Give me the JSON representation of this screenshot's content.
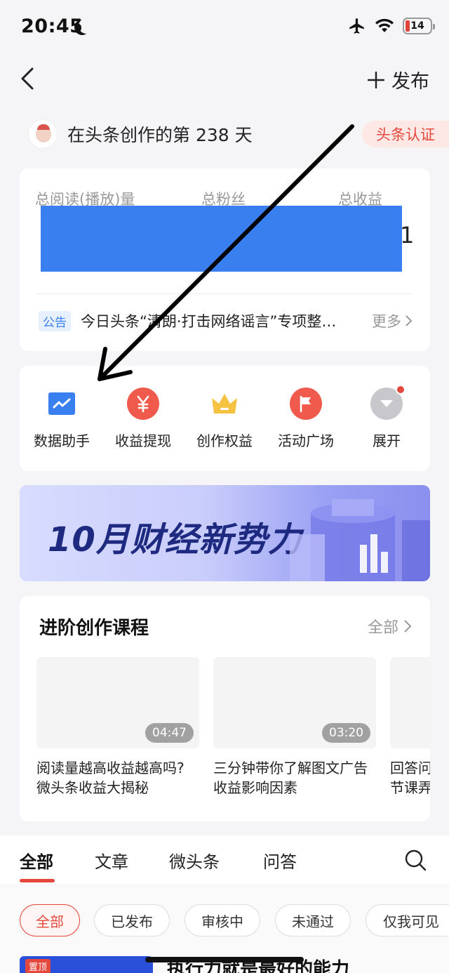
{
  "status_bar": {
    "time": "20:45",
    "battery": "14"
  },
  "nav": {
    "publish_label": "发布"
  },
  "creator": {
    "text": "在头条创作的第 238 天",
    "badge": "头条认证"
  },
  "stats": {
    "labels": [
      "总阅读(播放)量",
      "总粉丝",
      "总收益"
    ],
    "tail_digit": "1",
    "notice_tag": "公告",
    "notice_text": "今日头条“清朗·打击网络谣言”专项整…",
    "notice_more": "更多"
  },
  "actions": [
    {
      "label": "数据助手",
      "icon": "chart-icon",
      "color": "#3a7ff0"
    },
    {
      "label": "收益提现",
      "icon": "yuan-icon",
      "color": "#ef5a4c"
    },
    {
      "label": "创作权益",
      "icon": "crown-icon",
      "color": "#f5c242"
    },
    {
      "label": "活动广场",
      "icon": "flag-icon",
      "color": "#ef5a4c"
    },
    {
      "label": "展开",
      "icon": "expand-icon",
      "color": "#c8c8cc"
    }
  ],
  "banner": {
    "text": "10月财经新势力"
  },
  "courses": {
    "title": "进阶创作课程",
    "all_label": "全部",
    "items": [
      {
        "duration": "04:47",
        "line1": "阅读量越高收益越高吗?",
        "line2": "微头条收益大揭秘"
      },
      {
        "duration": "03:20",
        "line1": "三分钟带你了解图文广告",
        "line2": "收益影响因素"
      },
      {
        "duration": "",
        "line1": "回答问",
        "line2": "节课弄"
      }
    ]
  },
  "tabs": [
    "全部",
    "文章",
    "微头条",
    "问答"
  ],
  "filters": [
    "全部",
    "已发布",
    "审核中",
    "未通过",
    "仅我可见"
  ],
  "article": {
    "pin_tag": "置顶",
    "title": "执行力就是最好的能力"
  },
  "colors": {
    "accent": "#e4473b",
    "blue": "#3a7ff0"
  }
}
